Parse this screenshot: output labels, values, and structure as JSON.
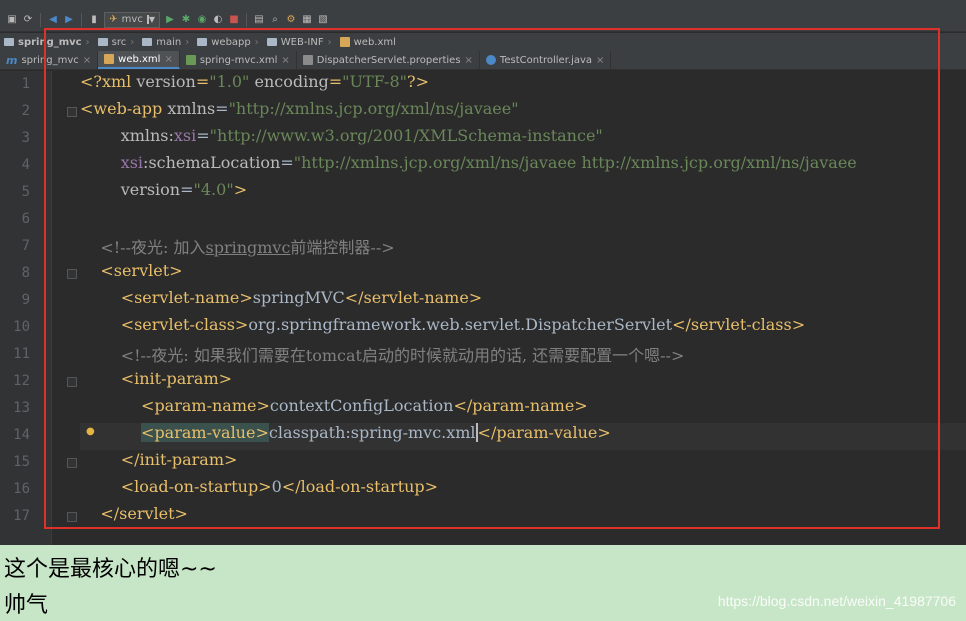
{
  "toolbar": {
    "run_config": "mvc"
  },
  "breadcrumb": [
    "spring_mvc",
    "src",
    "main",
    "webapp",
    "WEB-INF",
    "web.xml"
  ],
  "tabs": [
    {
      "label": "spring_mvc"
    },
    {
      "label": "web.xml"
    },
    {
      "label": "spring-mvc.xml"
    },
    {
      "label": "DispatcherServlet.properties"
    },
    {
      "label": "TestController.java"
    }
  ],
  "editor": {
    "lines": [
      {
        "n": "1",
        "segs": [
          [
            "tag",
            "<?xml "
          ],
          [
            "attr",
            "version"
          ],
          [
            "tag",
            "="
          ],
          [
            "str",
            "\"1.0\""
          ],
          [
            "attr",
            " encoding"
          ],
          [
            "tag",
            "="
          ],
          [
            "str",
            "\"UTF-8\""
          ],
          [
            "tag",
            "?>"
          ]
        ]
      },
      {
        "n": "2",
        "segs": [
          [
            "tag",
            "<web-app "
          ],
          [
            "attr",
            "xmlns"
          ],
          [
            "text",
            "="
          ],
          [
            "str",
            "\"http://xmlns.jcp.org/xml/ns/javaee\""
          ]
        ]
      },
      {
        "n": "3",
        "segs": [
          [
            "text",
            "        "
          ],
          [
            "attr",
            "xmlns:"
          ],
          [
            "ns",
            "xsi"
          ],
          [
            "text",
            "="
          ],
          [
            "str",
            "\"http://www.w3.org/2001/XMLSchema-instance\""
          ]
        ]
      },
      {
        "n": "4",
        "segs": [
          [
            "text",
            "        "
          ],
          [
            "ns",
            "xsi"
          ],
          [
            "attr",
            ":schemaLocation"
          ],
          [
            "text",
            "="
          ],
          [
            "str",
            "\"http://xmlns.jcp.org/xml/ns/javaee http://xmlns.jcp.org/xml/ns/javaee"
          ]
        ]
      },
      {
        "n": "5",
        "segs": [
          [
            "text",
            "        "
          ],
          [
            "attr",
            "version"
          ],
          [
            "text",
            "="
          ],
          [
            "str",
            "\"4.0\""
          ],
          [
            "tag",
            ">"
          ]
        ]
      },
      {
        "n": "6",
        "segs": []
      },
      {
        "n": "7",
        "segs": [
          [
            "text",
            "    "
          ],
          [
            "comment",
            "<!--夜光: 加入"
          ],
          [
            "commentu",
            "springmvc"
          ],
          [
            "comment",
            "前端控制器-->"
          ]
        ]
      },
      {
        "n": "8",
        "segs": [
          [
            "text",
            "    "
          ],
          [
            "tag",
            "<servlet>"
          ]
        ]
      },
      {
        "n": "9",
        "segs": [
          [
            "text",
            "        "
          ],
          [
            "tag",
            "<servlet-name>"
          ],
          [
            "text",
            "springMVC"
          ],
          [
            "tag",
            "</servlet-name>"
          ]
        ]
      },
      {
        "n": "10",
        "segs": [
          [
            "text",
            "        "
          ],
          [
            "tag",
            "<servlet-class>"
          ],
          [
            "text",
            "org.springframework.web.servlet.DispatcherServlet"
          ],
          [
            "tag",
            "</servlet-class>"
          ]
        ]
      },
      {
        "n": "11",
        "segs": [
          [
            "text",
            "        "
          ],
          [
            "comment",
            "<!--夜光: 如果我们需要在tomcat启动的时候就动用的话, 还需要配置一个嗯-->"
          ]
        ]
      },
      {
        "n": "12",
        "segs": [
          [
            "text",
            "        "
          ],
          [
            "tag",
            "<init-param>"
          ]
        ]
      },
      {
        "n": "13",
        "segs": [
          [
            "text",
            "            "
          ],
          [
            "tag",
            "<param-name>"
          ],
          [
            "text",
            "contextConfigLocation"
          ],
          [
            "tag",
            "</param-name>"
          ]
        ]
      },
      {
        "n": "14",
        "segs": [
          [
            "text",
            "            "
          ],
          [
            "taghl",
            "<param-value>"
          ],
          [
            "text",
            "classpath:spring-mvc.xml"
          ],
          [
            "tagcaret",
            "</param-value>"
          ]
        ]
      },
      {
        "n": "15",
        "segs": [
          [
            "text",
            "        "
          ],
          [
            "tag",
            "</init-param>"
          ]
        ]
      },
      {
        "n": "16",
        "segs": [
          [
            "text",
            "        "
          ],
          [
            "tag",
            "<load-on-startup>"
          ],
          [
            "text",
            "0"
          ],
          [
            "tag",
            "</load-on-startup>"
          ]
        ]
      },
      {
        "n": "17",
        "segs": [
          [
            "text",
            "    "
          ],
          [
            "tag",
            "</servlet>"
          ]
        ]
      }
    ]
  },
  "blog": {
    "line1": "这个是最核心的嗯~~",
    "line2": "帅气",
    "watermark": "https://blog.csdn.net/weixin_41987706"
  }
}
